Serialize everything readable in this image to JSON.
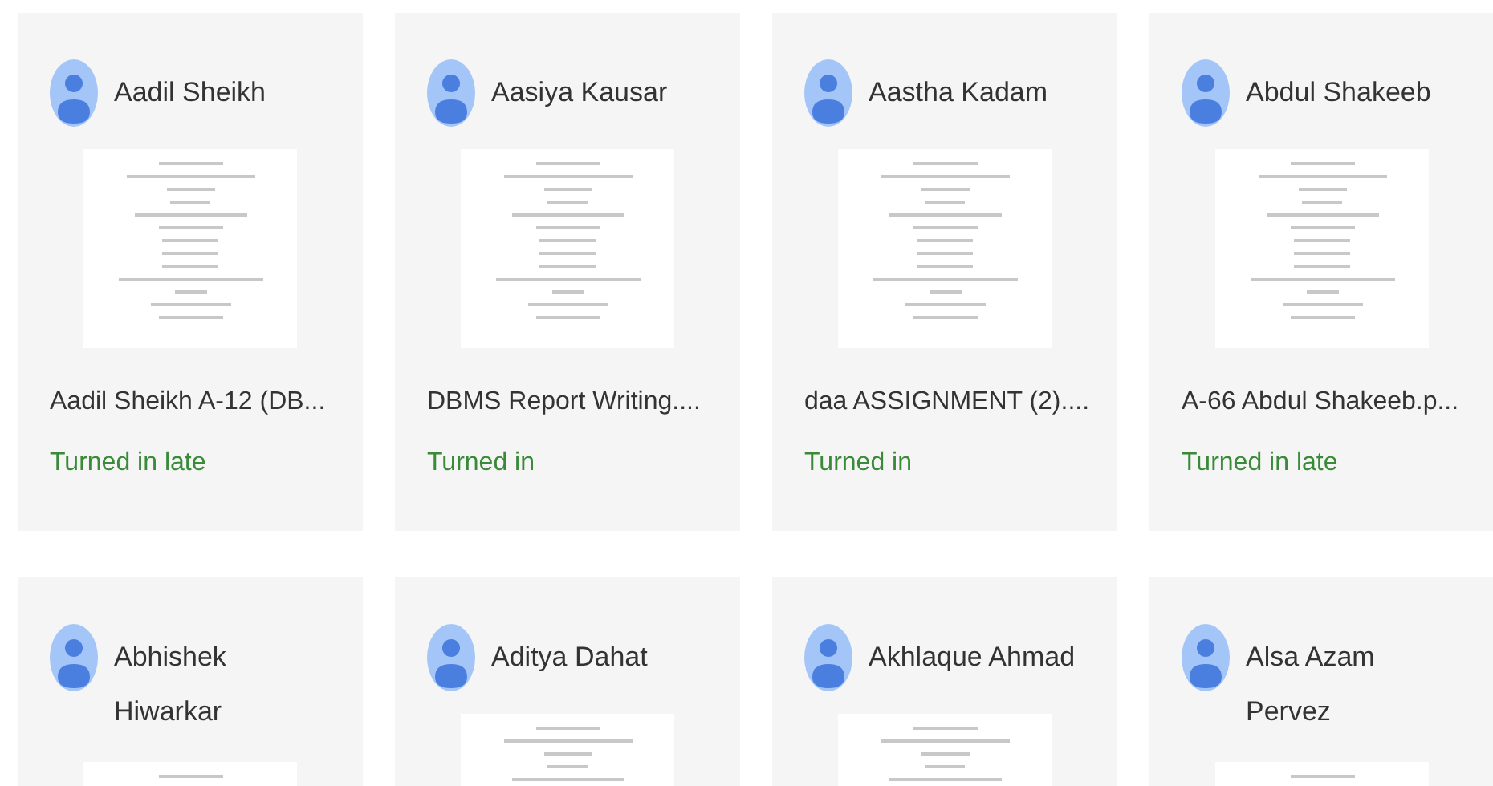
{
  "submissions": [
    {
      "student": "Aadil Sheikh",
      "file": "Aadil Sheikh A-12 (DB...",
      "status": "Turned in late"
    },
    {
      "student": "Aasiya Kausar",
      "file": "DBMS Report Writing....",
      "status": "Turned in"
    },
    {
      "student": "Aastha Kadam",
      "file": "daa ASSIGNMENT (2)....",
      "status": "Turned in"
    },
    {
      "student": "Abdul Shakeeb",
      "file": "A-66 Abdul Shakeeb.p...",
      "status": "Turned in late"
    },
    {
      "student": "Abhishek Hiwarkar"
    },
    {
      "student": "Aditya Dahat"
    },
    {
      "student": "Akhlaque Ahmad"
    },
    {
      "student": "Alsa Azam Pervez"
    }
  ]
}
